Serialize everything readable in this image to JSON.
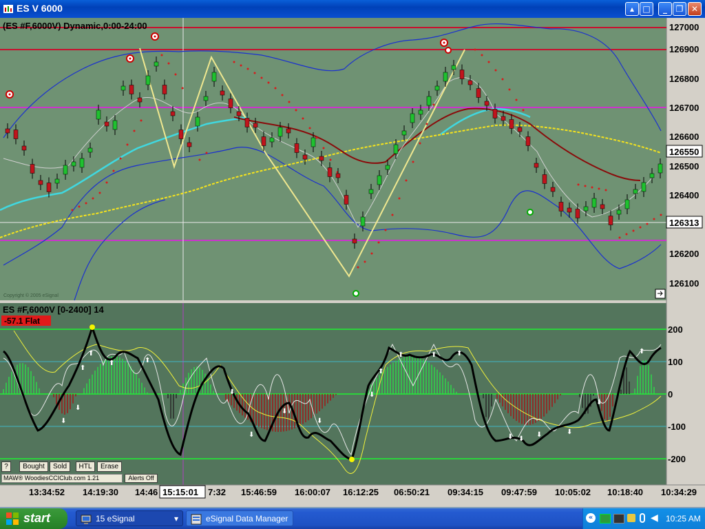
{
  "window": {
    "title": "ES V 6000"
  },
  "price_pane": {
    "header": "(ES #F,6000V) Dynamic,0:00-24:00",
    "copyright": "Copyright © 2005 eSignal",
    "axis_ticks": [
      "127000",
      "126900",
      "126800",
      "126700",
      "126600",
      "126500",
      "126400",
      "126200",
      "126100"
    ],
    "last_price": "126550",
    "crosshair_price": "126313"
  },
  "cci_pane": {
    "header": "ES #F,6000V [0-2400] 14",
    "status_value": "-57.1 Flat",
    "axis_ticks": [
      "200",
      "100",
      "0",
      "-100",
      "-200"
    ],
    "buttons": {
      "help": "?",
      "bought": "Bought",
      "sold": "Sold",
      "htl": "HTL",
      "erase": "Erase"
    },
    "credit": "MAW® WoodiesCCIClub.com 1.21",
    "alerts": "Alerts Off"
  },
  "time_axis": {
    "labels": [
      "13:34:52",
      "14:19:30",
      "14:46",
      "7:32",
      "15:46:59",
      "16:00:07",
      "16:12:25",
      "06:50:21",
      "09:34:15",
      "09:47:59",
      "10:05:02",
      "10:18:40",
      "10:34:29"
    ],
    "crosshair_time": "15:15:01"
  },
  "taskbar": {
    "start": "start",
    "items": [
      "15 eSignal",
      "eSignal Data Manager"
    ],
    "clock": "10:25 AM"
  },
  "colors": {
    "chart_bg": "#6f9273",
    "cci_bg": "#53755c",
    "axis_bg": "#d4d0c8",
    "resistance": "#c8102e",
    "pivot": "#cc33cc",
    "bollinger": "#1a2fd0",
    "zigzag": "#f0e890",
    "ema_slow": "#f7e41c",
    "ema_fast": "#40d8e0"
  }
}
